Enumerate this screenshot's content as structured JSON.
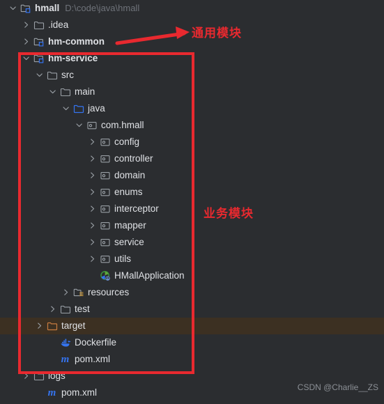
{
  "window": {
    "background_color": "#2b2d30",
    "text_color": "#dfe1e5"
  },
  "project_tree": {
    "rows": [
      {
        "label": "hmall",
        "secondary": "D:\\code\\java\\hmall",
        "indent": 0,
        "toggle": "expanded",
        "icon": "module-folder-icon",
        "bold": true,
        "name": "tree-row-hmall"
      },
      {
        "label": ".idea",
        "secondary": "",
        "indent": 1,
        "toggle": "collapsed",
        "icon": "folder-icon",
        "bold": false,
        "name": "tree-row-idea"
      },
      {
        "label": "hm-common",
        "secondary": "",
        "indent": 1,
        "toggle": "collapsed",
        "icon": "module-folder-icon",
        "bold": true,
        "name": "tree-row-hm-common"
      },
      {
        "label": "hm-service",
        "secondary": "",
        "indent": 1,
        "toggle": "expanded",
        "icon": "module-folder-icon",
        "bold": true,
        "name": "tree-row-hm-service"
      },
      {
        "label": "src",
        "secondary": "",
        "indent": 2,
        "toggle": "expanded",
        "icon": "folder-icon",
        "bold": false,
        "name": "tree-row-src"
      },
      {
        "label": "main",
        "secondary": "",
        "indent": 3,
        "toggle": "expanded",
        "icon": "folder-icon",
        "bold": false,
        "name": "tree-row-main"
      },
      {
        "label": "java",
        "secondary": "",
        "indent": 4,
        "toggle": "expanded",
        "icon": "source-folder-icon",
        "bold": false,
        "name": "tree-row-java"
      },
      {
        "label": "com.hmall",
        "secondary": "",
        "indent": 5,
        "toggle": "expanded",
        "icon": "package-icon",
        "bold": false,
        "name": "tree-row-com-hmall"
      },
      {
        "label": "config",
        "secondary": "",
        "indent": 6,
        "toggle": "collapsed",
        "icon": "package-icon",
        "bold": false,
        "name": "tree-row-config"
      },
      {
        "label": "controller",
        "secondary": "",
        "indent": 6,
        "toggle": "collapsed",
        "icon": "package-icon",
        "bold": false,
        "name": "tree-row-controller"
      },
      {
        "label": "domain",
        "secondary": "",
        "indent": 6,
        "toggle": "collapsed",
        "icon": "package-icon",
        "bold": false,
        "name": "tree-row-domain"
      },
      {
        "label": "enums",
        "secondary": "",
        "indent": 6,
        "toggle": "collapsed",
        "icon": "package-icon",
        "bold": false,
        "name": "tree-row-enums"
      },
      {
        "label": "interceptor",
        "secondary": "",
        "indent": 6,
        "toggle": "collapsed",
        "icon": "package-icon",
        "bold": false,
        "name": "tree-row-interceptor"
      },
      {
        "label": "mapper",
        "secondary": "",
        "indent": 6,
        "toggle": "collapsed",
        "icon": "package-icon",
        "bold": false,
        "name": "tree-row-mapper"
      },
      {
        "label": "service",
        "secondary": "",
        "indent": 6,
        "toggle": "collapsed",
        "icon": "package-icon",
        "bold": false,
        "name": "tree-row-service"
      },
      {
        "label": "utils",
        "secondary": "",
        "indent": 6,
        "toggle": "collapsed",
        "icon": "package-icon",
        "bold": false,
        "name": "tree-row-utils"
      },
      {
        "label": "HMallApplication",
        "secondary": "",
        "indent": 6,
        "toggle": "none",
        "icon": "spring-boot-class-icon",
        "bold": false,
        "name": "tree-row-hmallapplication"
      },
      {
        "label": "resources",
        "secondary": "",
        "indent": 4,
        "toggle": "collapsed",
        "icon": "resources-folder-icon",
        "bold": false,
        "name": "tree-row-resources"
      },
      {
        "label": "test",
        "secondary": "",
        "indent": 3,
        "toggle": "collapsed",
        "icon": "folder-icon",
        "bold": false,
        "name": "tree-row-test"
      },
      {
        "label": "target",
        "secondary": "",
        "indent": 2,
        "toggle": "collapsed",
        "icon": "excluded-folder-icon",
        "bold": false,
        "name": "tree-row-target",
        "highlight": true
      },
      {
        "label": "Dockerfile",
        "secondary": "",
        "indent": 3,
        "toggle": "none",
        "icon": "docker-icon",
        "bold": false,
        "name": "tree-row-dockerfile"
      },
      {
        "label": "pom.xml",
        "secondary": "",
        "indent": 3,
        "toggle": "none",
        "icon": "maven-icon",
        "bold": false,
        "name": "tree-row-pom-xml-service"
      },
      {
        "label": "logs",
        "secondary": "",
        "indent": 1,
        "toggle": "collapsed",
        "icon": "folder-icon",
        "bold": false,
        "name": "tree-row-logs"
      },
      {
        "label": "pom.xml",
        "secondary": "",
        "indent": 2,
        "toggle": "none",
        "icon": "maven-icon",
        "bold": false,
        "name": "tree-row-pom-xml-root"
      }
    ]
  },
  "annotations": {
    "color": "#e8292f",
    "common_module_label": "通用模块",
    "business_module_label": "业务模块"
  },
  "watermark": {
    "text": "CSDN @Charlie__ZS"
  }
}
